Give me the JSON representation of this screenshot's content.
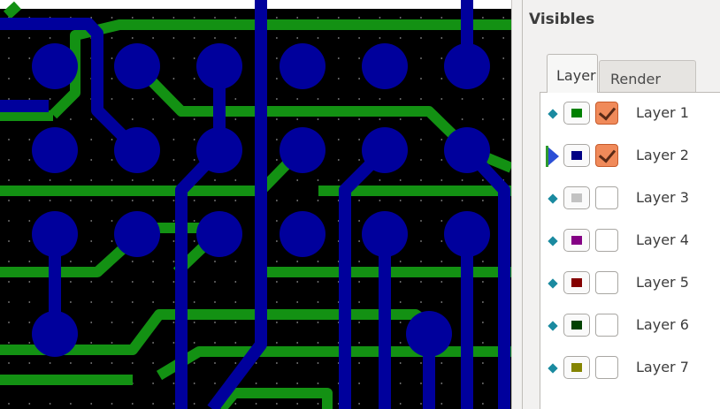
{
  "panel": {
    "title": "Visibles"
  },
  "tabs": [
    {
      "label": "Layer"
    },
    {
      "label": "Render"
    }
  ],
  "layers": [
    {
      "label": "Layer 1",
      "color": "#008000",
      "checked": true,
      "active": false
    },
    {
      "label": "Layer 2",
      "color": "#000084",
      "checked": true,
      "active": true
    },
    {
      "label": "Layer 3",
      "color": "#c2c2c2",
      "checked": false,
      "active": false
    },
    {
      "label": "Layer 4",
      "color": "#840084",
      "checked": false,
      "active": false
    },
    {
      "label": "Layer 5",
      "color": "#840000",
      "checked": false,
      "active": false
    },
    {
      "label": "Layer 6",
      "color": "#004200",
      "checked": false,
      "active": false
    },
    {
      "label": "Layer 7",
      "color": "#848400",
      "checked": false,
      "active": false
    }
  ],
  "board": {
    "background": "#000000",
    "front_copper": "#00009c",
    "back_copper": "#139113",
    "grid": "#8a8a8a"
  }
}
